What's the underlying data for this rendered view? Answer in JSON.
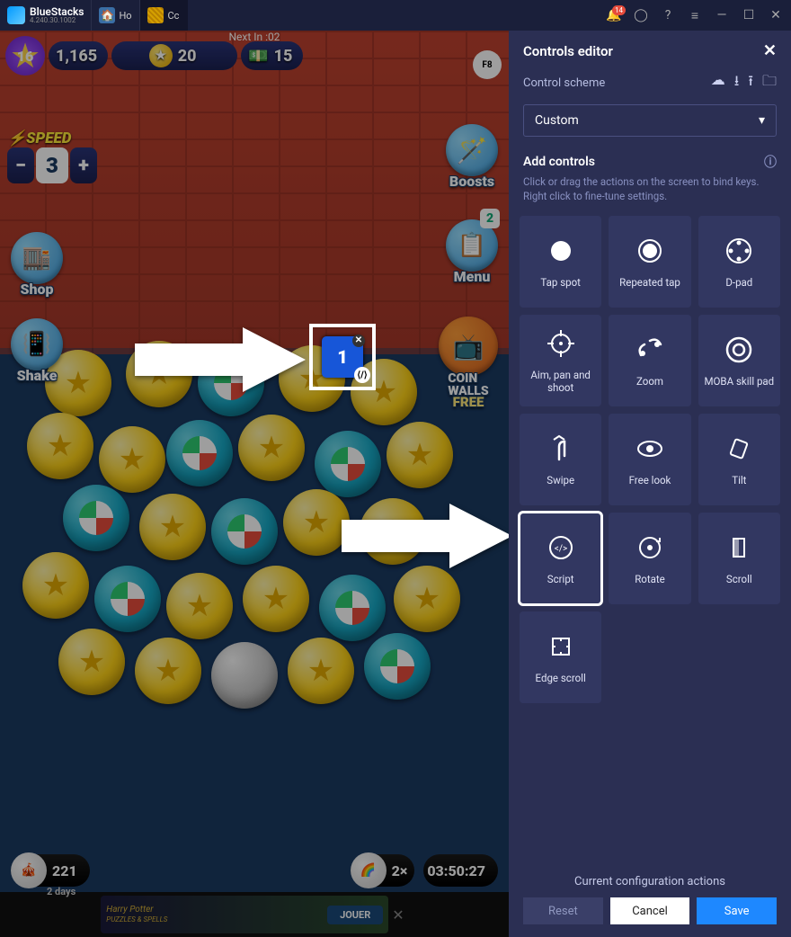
{
  "titlebar": {
    "app_name": "BlueStacks",
    "version": "4.240.30.1002",
    "tabs": [
      {
        "label": "Ho",
        "icon": "home-icon"
      },
      {
        "label": "Cc",
        "icon": "coin-app-icon"
      }
    ],
    "notification_count": "14"
  },
  "game_hud": {
    "level": "16",
    "xp": "1,165",
    "coins": "20",
    "next_in": "Next In :02",
    "cash": "15",
    "fn_key": "F8",
    "speed_label": "SPEED",
    "speed_value": "3",
    "buttons": {
      "boosts": "Boosts",
      "shop": "Shop",
      "menu": "Menu",
      "shake": "Shake",
      "coin_walls": "COIN\nWALLS",
      "coin_walls_free": "FREE"
    },
    "menu_badge": "2",
    "bottom": {
      "streak_count": "221",
      "streak_days": "2 days",
      "multiplier": "2×",
      "timer": "03:50:27"
    },
    "script_control": "1"
  },
  "ad": {
    "title": "Harry Potter",
    "subtitle": "PUZZLES & SPELLS",
    "cta": "JOUER"
  },
  "panel": {
    "title": "Controls editor",
    "scheme_label": "Control scheme",
    "scheme_value": "Custom",
    "add_title": "Add controls",
    "add_subtitle": "Click or drag the actions on the screen to bind keys. Right click to fine-tune settings.",
    "tiles": [
      {
        "id": "tap-spot",
        "label": "Tap spot"
      },
      {
        "id": "repeated-tap",
        "label": "Repeated tap"
      },
      {
        "id": "d-pad",
        "label": "D-pad"
      },
      {
        "id": "aim-pan-shoot",
        "label": "Aim, pan and shoot"
      },
      {
        "id": "zoom",
        "label": "Zoom"
      },
      {
        "id": "moba-skill-pad",
        "label": "MOBA skill pad"
      },
      {
        "id": "swipe",
        "label": "Swipe"
      },
      {
        "id": "free-look",
        "label": "Free look"
      },
      {
        "id": "tilt",
        "label": "Tilt"
      },
      {
        "id": "script",
        "label": "Script",
        "highlighted": true
      },
      {
        "id": "rotate",
        "label": "Rotate"
      },
      {
        "id": "scroll",
        "label": "Scroll"
      },
      {
        "id": "edge-scroll",
        "label": "Edge scroll"
      }
    ],
    "footer_title": "Current configuration actions",
    "reset": "Reset",
    "cancel": "Cancel",
    "save": "Save"
  }
}
